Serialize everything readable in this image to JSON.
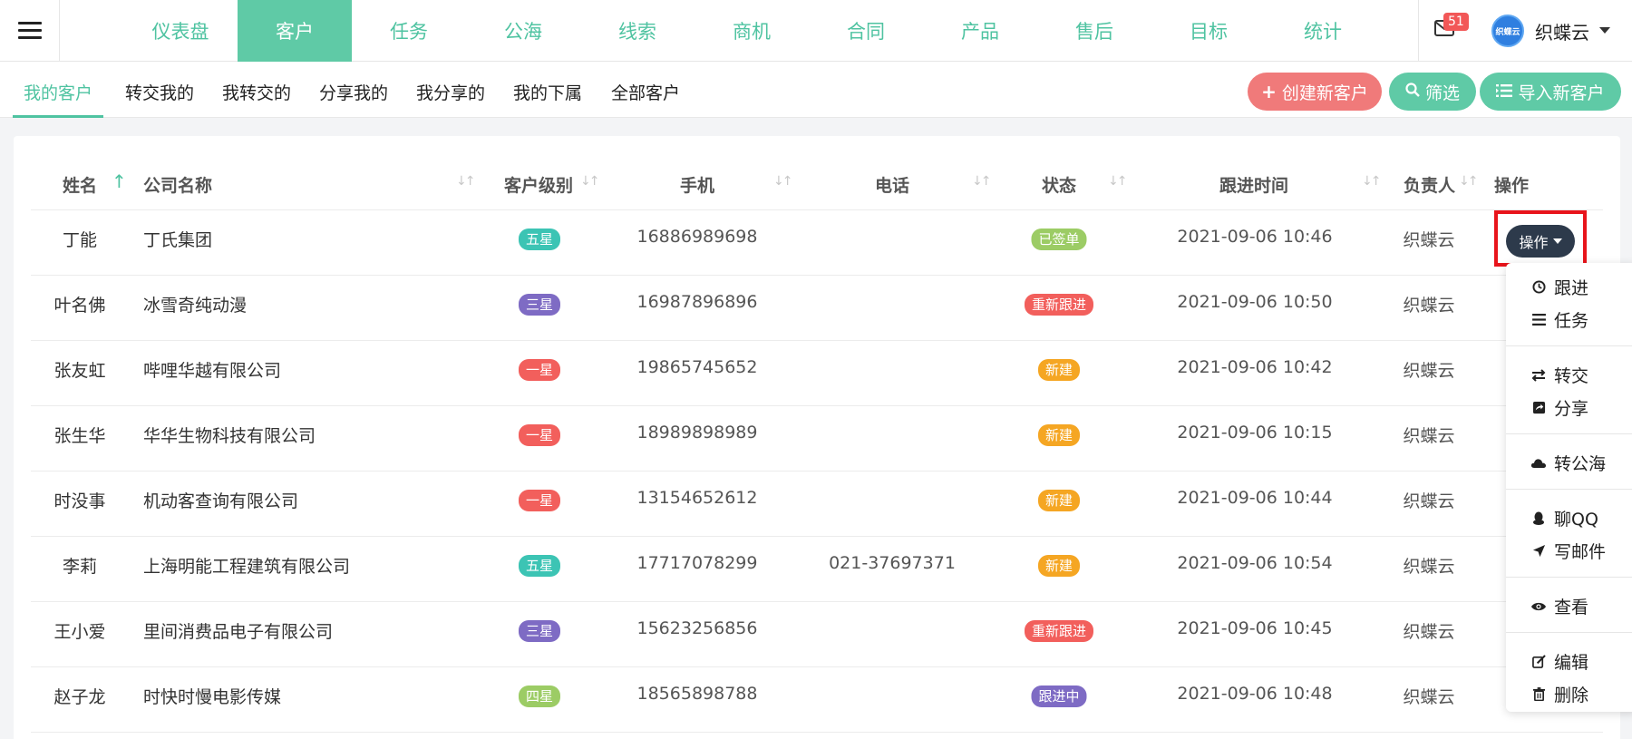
{
  "nav": {
    "items": [
      "仪表盘",
      "客户",
      "任务",
      "公海",
      "线索",
      "商机",
      "合同",
      "产品",
      "售后",
      "目标",
      "统计"
    ],
    "active_index": 1,
    "mail_count": "51",
    "avatar_text": "织蝶云",
    "username": "织蝶云"
  },
  "subtabs": {
    "items": [
      "我的客户",
      "转交我的",
      "我转交的",
      "分享我的",
      "我分享的",
      "我的下属",
      "全部客户"
    ],
    "active_index": 0
  },
  "buttons": {
    "create": "创建新客户",
    "filter": "筛选",
    "import": "导入新客户"
  },
  "table": {
    "headers": {
      "name": "姓名",
      "company": "公司名称",
      "level": "客户级别",
      "mobile": "手机",
      "phone": "电话",
      "status": "状态",
      "follow_time": "跟进时间",
      "owner": "负责人",
      "ops": "操作"
    },
    "rows": [
      {
        "name": "丁能",
        "company": "丁氏集团",
        "level": "五星",
        "mobile": "16886989698",
        "phone": "",
        "status": "已签单",
        "follow_time": "2021-09-06 10:46",
        "owner": "织蝶云"
      },
      {
        "name": "叶名佛",
        "company": "冰雪奇纯动漫",
        "level": "三星",
        "mobile": "16987896896",
        "phone": "",
        "status": "重新跟进",
        "follow_time": "2021-09-06 10:50",
        "owner": "织蝶云"
      },
      {
        "name": "张友虹",
        "company": "哔哩华越有限公司",
        "level": "一星",
        "mobile": "19865745652",
        "phone": "",
        "status": "新建",
        "follow_time": "2021-09-06 10:42",
        "owner": "织蝶云"
      },
      {
        "name": "张生华",
        "company": "华华生物科技有限公司",
        "level": "一星",
        "mobile": "18989898989",
        "phone": "",
        "status": "新建",
        "follow_time": "2021-09-06 10:15",
        "owner": "织蝶云"
      },
      {
        "name": "时没事",
        "company": "机动客查询有限公司",
        "level": "一星",
        "mobile": "13154652612",
        "phone": "",
        "status": "新建",
        "follow_time": "2021-09-06 10:44",
        "owner": "织蝶云"
      },
      {
        "name": "李莉",
        "company": "上海明能工程建筑有限公司",
        "level": "五星",
        "mobile": "17717078299",
        "phone": "021-37697371",
        "status": "新建",
        "follow_time": "2021-09-06 10:54",
        "owner": "织蝶云"
      },
      {
        "name": "王小爱",
        "company": "里间消费品电子有限公司",
        "level": "三星",
        "mobile": "15623256856",
        "phone": "",
        "status": "重新跟进",
        "follow_time": "2021-09-06 10:45",
        "owner": "织蝶云"
      },
      {
        "name": "赵子龙",
        "company": "时快时慢电影传媒",
        "level": "四星",
        "mobile": "18565898788",
        "phone": "",
        "status": "跟进中",
        "follow_time": "2021-09-06 10:48",
        "owner": "织蝶云"
      }
    ]
  },
  "level_colors": {
    "五星": "#3cc4b4",
    "四星": "#9ccc65",
    "三星": "#7e6bc4",
    "一星": "#f25f5c"
  },
  "status_colors": {
    "已签单": "#9ccc65",
    "重新跟进": "#f25f5c",
    "新建": "#f5a623",
    "跟进中": "#7e6bc4"
  },
  "op_button": "操作",
  "dropdown": {
    "items": [
      {
        "label": "跟进",
        "icon": "clock-icon"
      },
      {
        "label": "任务",
        "icon": "list-icon"
      },
      {
        "label": "转交",
        "icon": "transfer-icon"
      },
      {
        "label": "分享",
        "icon": "share-icon"
      },
      {
        "label": "转公海",
        "icon": "cloud-icon"
      },
      {
        "label": "聊QQ",
        "icon": "qq-icon"
      },
      {
        "label": "写邮件",
        "icon": "send-icon"
      },
      {
        "label": "查看",
        "icon": "eye-icon"
      },
      {
        "label": "编辑",
        "icon": "edit-icon"
      },
      {
        "label": "删除",
        "icon": "trash-icon"
      }
    ]
  },
  "colors": {
    "accent": "#5fcaa6",
    "create_button": "#f07a7a",
    "op_button": "#2d3a4b",
    "highlight": "#e8141b"
  }
}
